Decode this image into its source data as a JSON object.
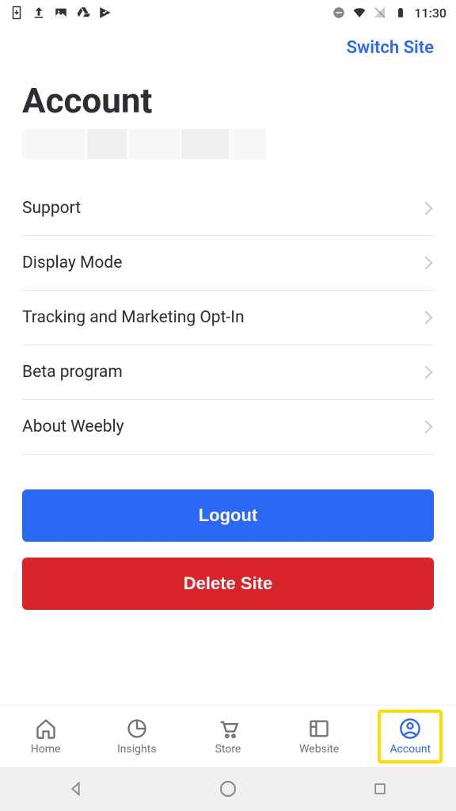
{
  "status": {
    "time": "11:30"
  },
  "header": {
    "switch_site": "Switch Site"
  },
  "page": {
    "title": "Account"
  },
  "settings": {
    "items": [
      {
        "label": "Support"
      },
      {
        "label": "Display Mode"
      },
      {
        "label": "Tracking and Marketing Opt-In"
      },
      {
        "label": "Beta program"
      },
      {
        "label": "About Weebly"
      }
    ]
  },
  "actions": {
    "logout": "Logout",
    "delete_site": "Delete Site"
  },
  "nav": {
    "items": [
      {
        "label": "Home"
      },
      {
        "label": "Insights"
      },
      {
        "label": "Store"
      },
      {
        "label": "Website"
      },
      {
        "label": "Account"
      }
    ]
  }
}
